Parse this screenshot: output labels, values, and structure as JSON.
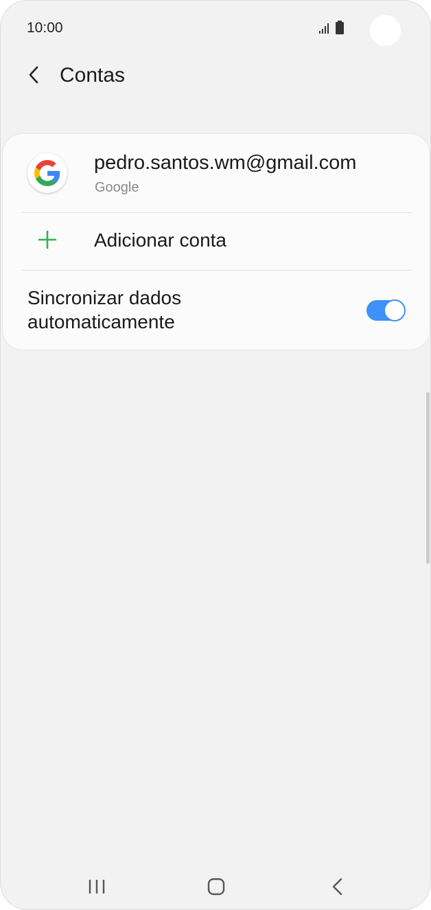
{
  "status_bar": {
    "time": "10:00",
    "icons": [
      "signal-icon",
      "battery-icon"
    ]
  },
  "app_bar": {
    "back_icon": "chevron-left-icon",
    "title": "Contas"
  },
  "accounts": {
    "items": [
      {
        "icon": "google-icon",
        "email": "pedro.santos.wm@gmail.com",
        "type": "Google"
      }
    ],
    "add_icon": "plus-icon",
    "add_label": "Adicionar conta",
    "sync_label": "Sincronizar dados automaticamente",
    "sync_enabled": true
  },
  "colors": {
    "accent": "#3e91f7",
    "add_icon": "#2fb34a",
    "background": "#f2f2f2",
    "card": "#fbfbfb"
  },
  "nav_bar": {
    "icons": [
      "recents-icon",
      "home-icon",
      "back-icon"
    ]
  }
}
